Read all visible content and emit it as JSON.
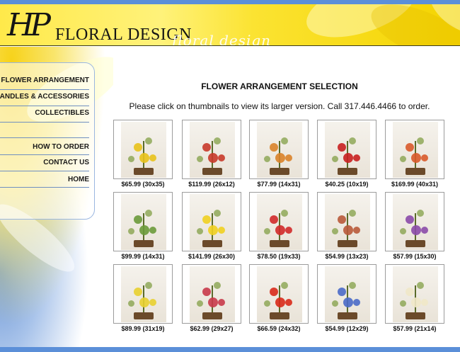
{
  "header": {
    "monogram": "HP",
    "title": "FLORAL DESIGN",
    "script": "floral design"
  },
  "nav": [
    {
      "label": "FLOWER ARRANGEMENT",
      "name": "nav-flower-arrangement"
    },
    {
      "label": "CANDLES & ACCESSORIES",
      "name": "nav-candles-accessories"
    },
    {
      "label": "COLLECTIBLES",
      "name": "nav-collectibles"
    },
    {
      "label": "HOW TO ORDER",
      "name": "nav-how-to-order"
    },
    {
      "label": "CONTACT US",
      "name": "nav-contact-us"
    },
    {
      "label": "HOME",
      "name": "nav-home"
    }
  ],
  "main": {
    "title": "FLOWER ARRANGEMENT SELECTION",
    "subtitle": "Please click on thumbnails to view its larger version. Call 317.446.4466 to order."
  },
  "products": [
    {
      "price": "$65.99 (30x35)",
      "accent": "#e8c21a"
    },
    {
      "price": "$119.99 (26x12)",
      "accent": "#c83a2a"
    },
    {
      "price": "$77.99 (14x31)",
      "accent": "#d9832a"
    },
    {
      "price": "$40.25 (10x19)",
      "accent": "#c82020"
    },
    {
      "price": "$169.99 (40x31)",
      "accent": "#d85a2a"
    },
    {
      "price": "$99.99 (14x31)",
      "accent": "#6a9a3a"
    },
    {
      "price": "$141.99 (26x30)",
      "accent": "#f0d020"
    },
    {
      "price": "$78.50 (19x33)",
      "accent": "#d02a2a"
    },
    {
      "price": "$54.99 (13x23)",
      "accent": "#b85a3a"
    },
    {
      "price": "$57.99 (15x30)",
      "accent": "#8a4aa8"
    },
    {
      "price": "$89.99 (31x19)",
      "accent": "#e8d030"
    },
    {
      "price": "$62.99 (29x27)",
      "accent": "#c83a4a"
    },
    {
      "price": "$66.59 (24x32)",
      "accent": "#d82a1a"
    },
    {
      "price": "$54.99 (12x29)",
      "accent": "#4a6ac8"
    },
    {
      "price": "$57.99 (21x14)",
      "accent": "#f0e8c8"
    }
  ]
}
